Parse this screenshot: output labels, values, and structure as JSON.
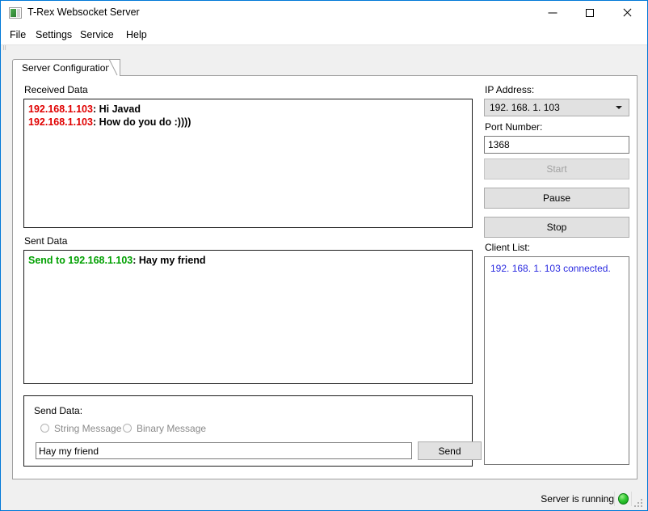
{
  "window": {
    "title": "T-Rex Websocket Server",
    "icon": "app-window-icon",
    "controls": {
      "minimize": "minimize-icon",
      "maximize": "maximize-icon",
      "close": "close-icon"
    }
  },
  "menu": {
    "items": [
      {
        "label": "File"
      },
      {
        "label": "Settings"
      },
      {
        "label": "Service"
      },
      {
        "label": "Help"
      }
    ]
  },
  "tabs": [
    {
      "label": "Server Configuration",
      "selected": true
    }
  ],
  "left_panel": {
    "received_data": {
      "label": "Received Data",
      "messages": [
        {
          "source": "192.168.1.103",
          "separator": ": ",
          "text": "Hi Javad",
          "source_color": "#e00000"
        },
        {
          "source": "192.168.1.103",
          "separator": ": ",
          "text": "How do you do :))))",
          "source_color": "#e00000"
        }
      ]
    },
    "sent_data": {
      "label": "Sent Data",
      "messages": [
        {
          "source": "Send to 192.168.1.103",
          "separator": ": ",
          "text": "Hay my friend",
          "source_color": "#00a000"
        }
      ]
    },
    "send_data_group": {
      "label": "Send Data:",
      "radios": [
        {
          "label": "String Message",
          "checked": false,
          "enabled": false
        },
        {
          "label": "Binary Message",
          "checked": false,
          "enabled": false
        }
      ],
      "input": {
        "value": "Hay my friend",
        "placeholder": ""
      },
      "send_button": "Send"
    }
  },
  "right_panel": {
    "ip_address": {
      "label": "IP Address:",
      "selected": "192. 168. 1. 103",
      "options": [
        "192. 168. 1. 103"
      ],
      "arrow_icon": "chevron-down-icon"
    },
    "port_number": {
      "label": "Port Number:",
      "value": "1368",
      "placeholder": ""
    },
    "buttons": [
      {
        "label": "Start",
        "enabled": false
      },
      {
        "label": "Pause",
        "enabled": true
      },
      {
        "label": "Stop",
        "enabled": true
      }
    ],
    "client_list": {
      "label": "Client List:",
      "items": [
        "192. 168. 1. 103 connected."
      ],
      "item_color": "#2a2ae0"
    }
  },
  "status_bar": {
    "text": "Server is running",
    "led": {
      "state": "running",
      "color": "#32c832",
      "icon": "status-led-icon"
    },
    "grip": "resize-grip-icon"
  }
}
